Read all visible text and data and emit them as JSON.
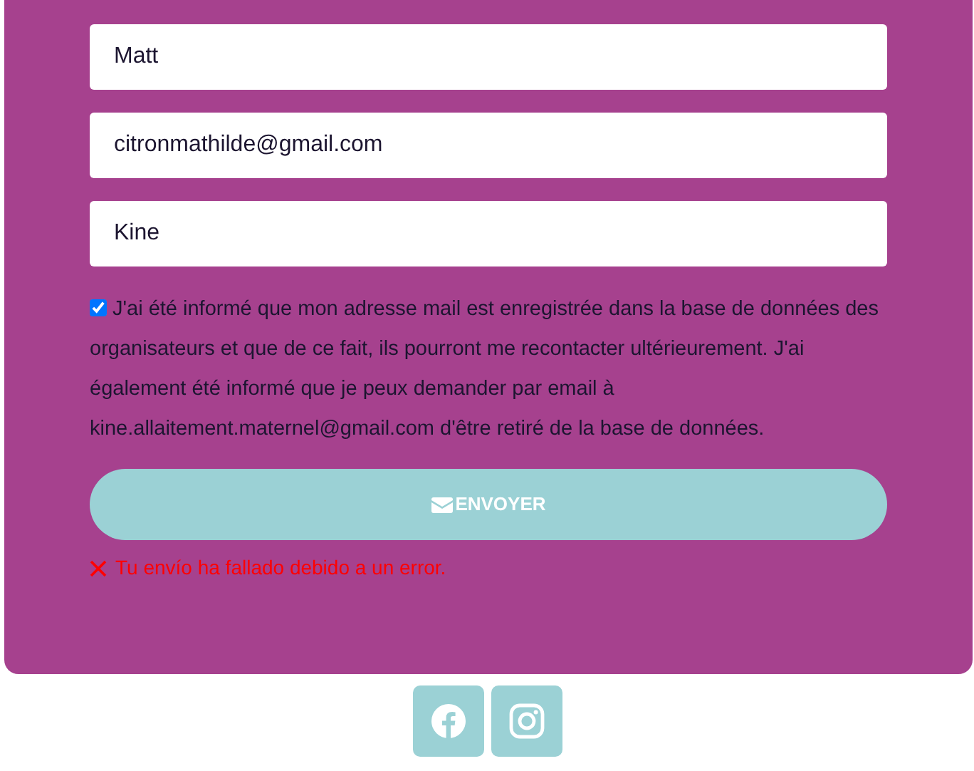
{
  "form": {
    "fields": [
      {
        "value": "Matt"
      },
      {
        "value": "citronmathilde@gmail.com"
      },
      {
        "value": "Kine"
      }
    ],
    "consent": {
      "checked": true,
      "text": "J'ai été informé que mon adresse mail est enregistrée dans la base de données des organisateurs et que de ce fait, ils pourront me recontacter ultérieurement. J'ai également été informé que je peux demander par email à kine.allaitement.maternel@gmail.com d'être retiré de la base de données."
    },
    "submit_button": {
      "label": "ENVOYER"
    },
    "error_message": "Tu envío ha fallado debido a un error."
  },
  "social_links": [
    {
      "kind": "facebook"
    },
    {
      "kind": "instagram"
    }
  ]
}
